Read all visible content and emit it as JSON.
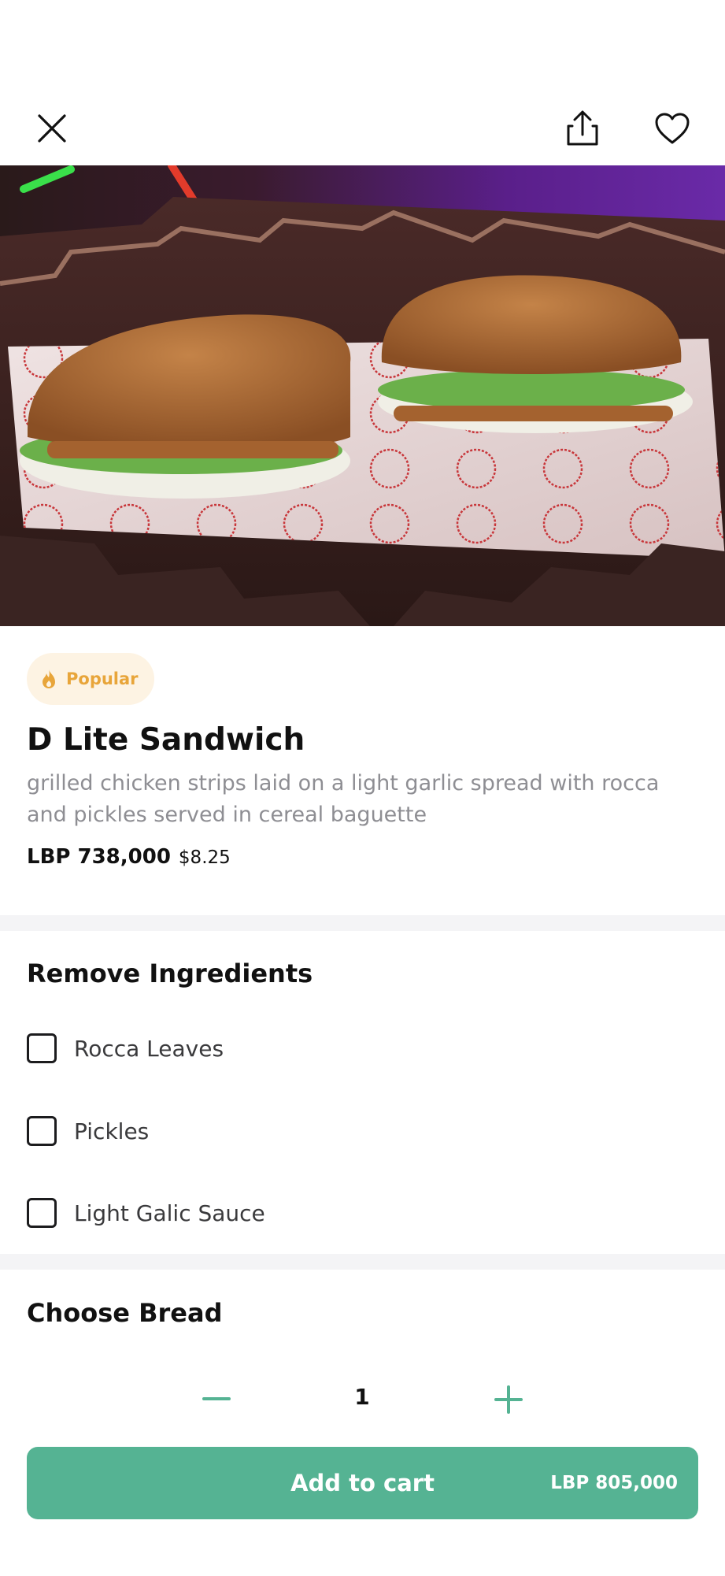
{
  "header": {
    "close_icon": "close-icon",
    "share_icon": "share-icon",
    "favorite_icon": "heart-icon"
  },
  "product": {
    "badge": "Popular",
    "badge_icon": "flame-icon",
    "name": "D Lite Sandwich",
    "description": "grilled chicken strips laid on a light garlic spread with rocca and pickles served in cereal baguette",
    "price_lbp": "LBP 738,000",
    "price_usd": "$8.25"
  },
  "remove_ingredients": {
    "title": "Remove Ingredients",
    "options": [
      {
        "label": "Rocca Leaves",
        "checked": false
      },
      {
        "label": "Pickles",
        "checked": false
      },
      {
        "label": "Light Galic Sauce",
        "checked": false
      }
    ]
  },
  "choose_bread": {
    "title": "Choose Bread"
  },
  "footer": {
    "quantity": "1",
    "add_to_cart_label": "Add to cart",
    "total": "LBP 805,000"
  },
  "colors": {
    "accent_green": "#55b393",
    "badge_bg": "#fdf3e3",
    "badge_text": "#e8a53a",
    "muted_text": "#8e8e93"
  }
}
